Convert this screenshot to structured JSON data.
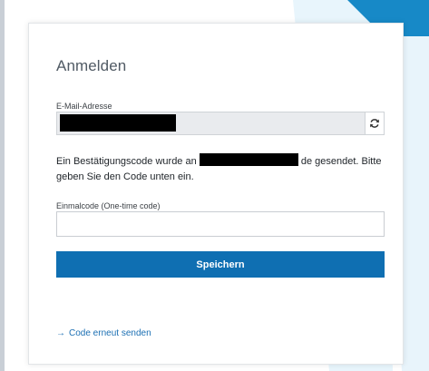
{
  "colors": {
    "accent": "#0f6fb2",
    "link": "#1b6fb3",
    "redaction": "#000000"
  },
  "form": {
    "title": "Anmelden",
    "email": {
      "label": "E-Mail-Adresse",
      "value": "",
      "refresh_icon": "refresh-icon"
    },
    "info": {
      "part1": "Ein Bestätigungscode wurde an ",
      "part2": " de gesendet. Bitte geben Sie den Code unten ein."
    },
    "otp": {
      "label": "Einmalcode (One-time code)",
      "value": "",
      "placeholder": ""
    },
    "save_label": "Speichern",
    "resend": {
      "arrow_icon": "arrow-right-icon",
      "label": "Code erneut senden"
    }
  }
}
